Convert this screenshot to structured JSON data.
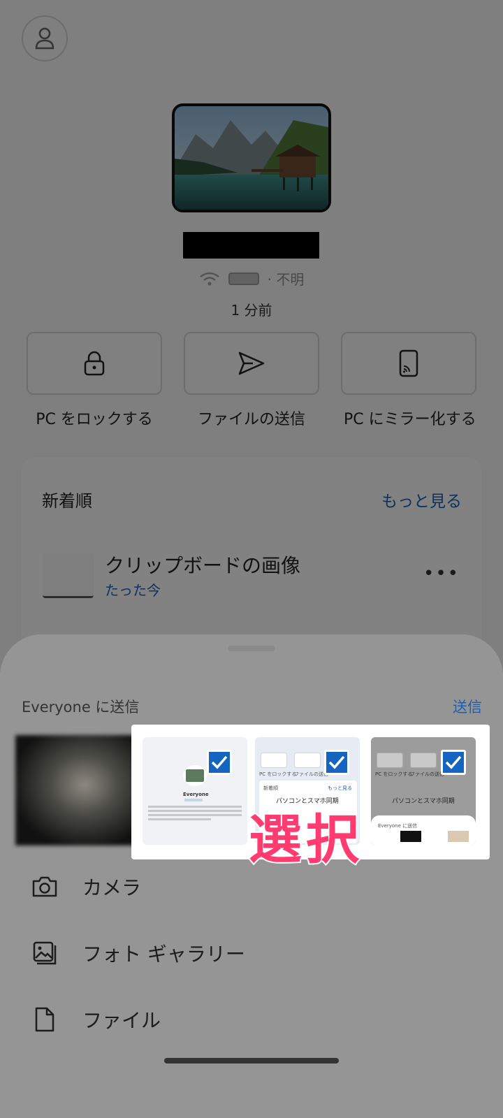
{
  "device": {
    "status_text": "· 不明",
    "last_seen": "1 分前"
  },
  "actions": [
    {
      "label": "PC をロックする",
      "icon": "lock-icon"
    },
    {
      "label": "ファイルの送信",
      "icon": "send-icon"
    },
    {
      "label": "PC にミラー化する",
      "icon": "phone-cast-icon"
    }
  ],
  "recent": {
    "title": "新着順",
    "more_label": "もっと見る",
    "item": {
      "name": "クリップボードの画像",
      "time": "たった今",
      "menu": "•••"
    }
  },
  "sheet": {
    "title": "Everyone に送信",
    "send_label": "送信",
    "annotation": "選択",
    "menu": [
      {
        "label": "カメラ",
        "icon": "camera-icon"
      },
      {
        "label": "フォト ギャラリー",
        "icon": "gallery-icon"
      },
      {
        "label": "ファイル",
        "icon": "file-icon"
      }
    ]
  },
  "thumbs": {
    "shot1": {
      "title": "Everyone"
    },
    "shot2": {
      "lock": "PC をロックする",
      "send": "ファイルの送信",
      "recent": "新着順",
      "more": "もっと見る",
      "item": "パソコンとスマホ同期"
    },
    "shot3": {
      "lock": "PC をロックする",
      "send": "ファイルの送信",
      "item": "パソコンとスマホ同期",
      "sheet": "Everyone に送信"
    }
  },
  "colors": {
    "accent": "#1565c0",
    "link": "#1a5fb4",
    "annotation": "#ff3b6f"
  }
}
